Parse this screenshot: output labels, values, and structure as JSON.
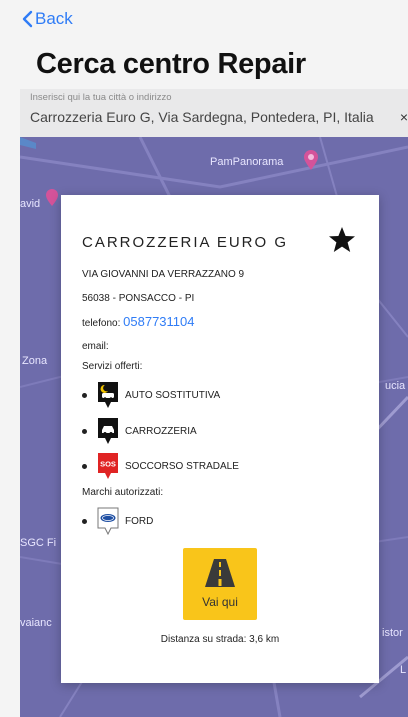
{
  "nav": {
    "back_label": "Back",
    "title": "Cerca centro Repair"
  },
  "search": {
    "label": "Inserisci qui la tua città o indirizzo",
    "value": "Carrozzeria Euro G, Via Sardegna, Pontedera, PI, Italia",
    "clear_icon": "×"
  },
  "map": {
    "labels": [
      "PamPanorama",
      "avid",
      "Zona",
      "ucia",
      "SGC Fi",
      "vaianc",
      "istor",
      "L"
    ]
  },
  "card": {
    "name": "CARROZZERIA EURO G",
    "address": "VIA GIOVANNI DA VERRAZZANO 9",
    "city": "56038 - PONSACCO - PI",
    "phone_label": "telefono:",
    "phone": "0587731104",
    "email_label": "email:",
    "services_label": "Servizi offerti:",
    "services": [
      "AUTO SOSTITUTIVA",
      "CARROZZERIA",
      "SOCCORSO STRADALE"
    ],
    "brands_label": "Marchi autorizzati:",
    "brands": [
      "FORD"
    ],
    "sos_badge": "SOS",
    "go_label": "Vai qui",
    "distance": "Distanza su strada: 3,6 km"
  },
  "colors": {
    "accent": "#2f7cf6",
    "go_button": "#f9c51a",
    "map": "#6e6cab",
    "sos": "#e02424"
  }
}
